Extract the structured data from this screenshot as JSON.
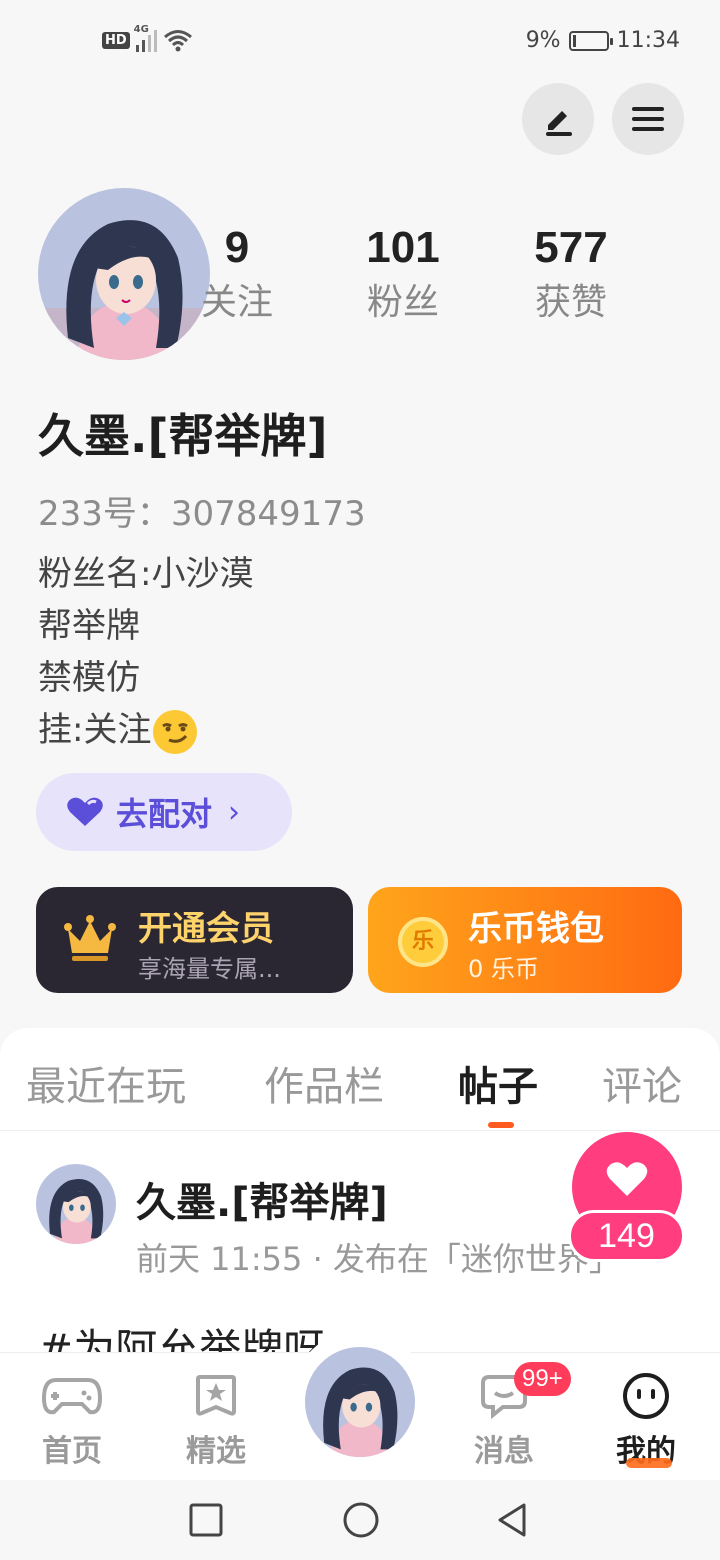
{
  "status_bar": {
    "hd": "HD",
    "network": "4G",
    "battery_percent": "9%",
    "time": "11:34"
  },
  "header": {
    "edit_icon": "pencil-icon",
    "menu_icon": "menu-icon"
  },
  "profile": {
    "stats": [
      {
        "value": "9",
        "label": "关注"
      },
      {
        "value": "101",
        "label": "粉丝"
      },
      {
        "value": "577",
        "label": "获赞"
      }
    ],
    "username": "久墨.[帮举牌]",
    "id_line": "233号：307849173",
    "bio": [
      "粉丝名:小沙漠",
      "帮举牌",
      "禁模仿",
      "挂:关注"
    ],
    "pair_button": "去配对",
    "pair_arrow": "›"
  },
  "cards": {
    "vip_title": "开通会员",
    "vip_sub": "享海量专属...",
    "coin_title": "乐币钱包",
    "coin_sub": "0 乐币",
    "coin_glyph": "乐"
  },
  "tabs": [
    {
      "label": "最近在玩",
      "active": false
    },
    {
      "label": "作品栏",
      "active": false
    },
    {
      "label": "帖子",
      "active": true
    },
    {
      "label": "评论",
      "active": false
    }
  ],
  "post": {
    "author": "久墨.[帮举牌]",
    "meta": "前天 11:55 · 发布在「迷你世界」",
    "text": "#为阿允举牌呀",
    "likes": "149"
  },
  "bottom_nav": {
    "items": [
      {
        "label": "首页",
        "icon": "gamepad-icon",
        "active": false
      },
      {
        "label": "精选",
        "icon": "star-bookmark-icon",
        "active": false
      },
      {
        "label": "消息",
        "icon": "chat-bubble-icon",
        "active": false,
        "badge": "99+"
      },
      {
        "label": "我的",
        "icon": "smiley-face-icon",
        "active": true
      }
    ]
  },
  "colors": {
    "accent": "#ff5a1f",
    "like_pink": "#ff3d7f",
    "pair_purple": "#5b4fd9",
    "vip_dark": "#2b2732",
    "vip_gold": "#ffd36b",
    "coin_orange": "#ff8a14"
  }
}
